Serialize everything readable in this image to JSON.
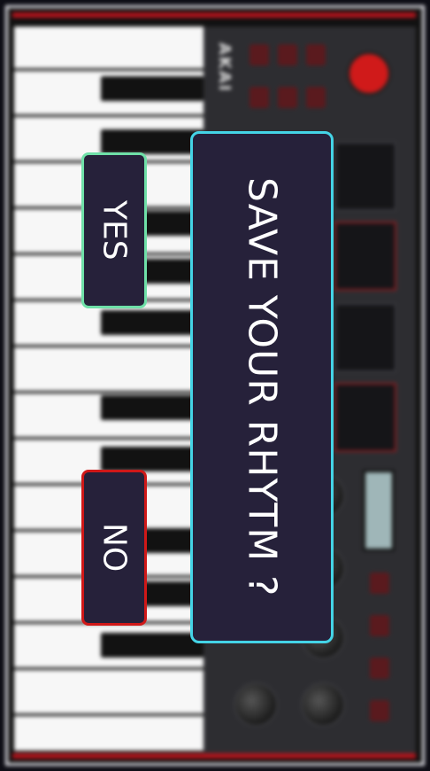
{
  "device": {
    "brand": "AKAI"
  },
  "dialog": {
    "title": "SAVE YOUR RHYTM ?",
    "yes_label": "YES",
    "no_label": "NO"
  },
  "colors": {
    "dialog_bg": "#26213a",
    "dialog_border": "#44d4e6",
    "yes_border": "#6fe0a8",
    "no_border": "#d01818"
  }
}
